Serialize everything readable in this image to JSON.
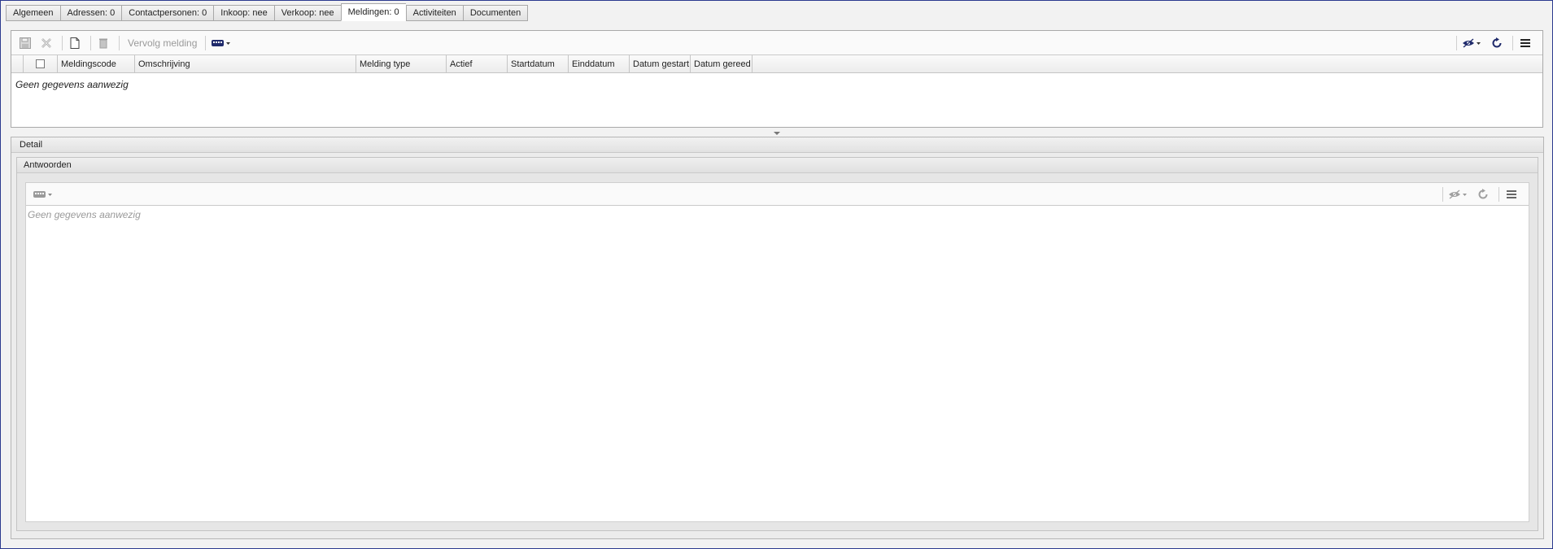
{
  "tabs": [
    {
      "label": "Algemeen",
      "active": false
    },
    {
      "label": "Adressen: 0",
      "active": false
    },
    {
      "label": "Contactpersonen: 0",
      "active": false
    },
    {
      "label": "Inkoop: nee",
      "active": false
    },
    {
      "label": "Verkoop: nee",
      "active": false
    },
    {
      "label": "Meldingen: 0",
      "active": true
    },
    {
      "label": "Activiteiten",
      "active": false
    },
    {
      "label": "Documenten",
      "active": false
    }
  ],
  "toolbar": {
    "vervolg_label": "Vervolg melding"
  },
  "grid": {
    "columns": [
      "Meldingscode",
      "Omschrijving",
      "Melding type",
      "Actief",
      "Startdatum",
      "Einddatum",
      "Datum gestart",
      "Datum gereed"
    ],
    "empty_text": "Geen gegevens aanwezig"
  },
  "detail": {
    "title": "Detail",
    "section_title": "Antwoorden",
    "empty_text": "Geen gegevens aanwezig"
  },
  "colors": {
    "frame_border": "#2b3a8f",
    "icon_blue": "#1f2a6b",
    "icon_disabled": "#a0a0a0"
  }
}
